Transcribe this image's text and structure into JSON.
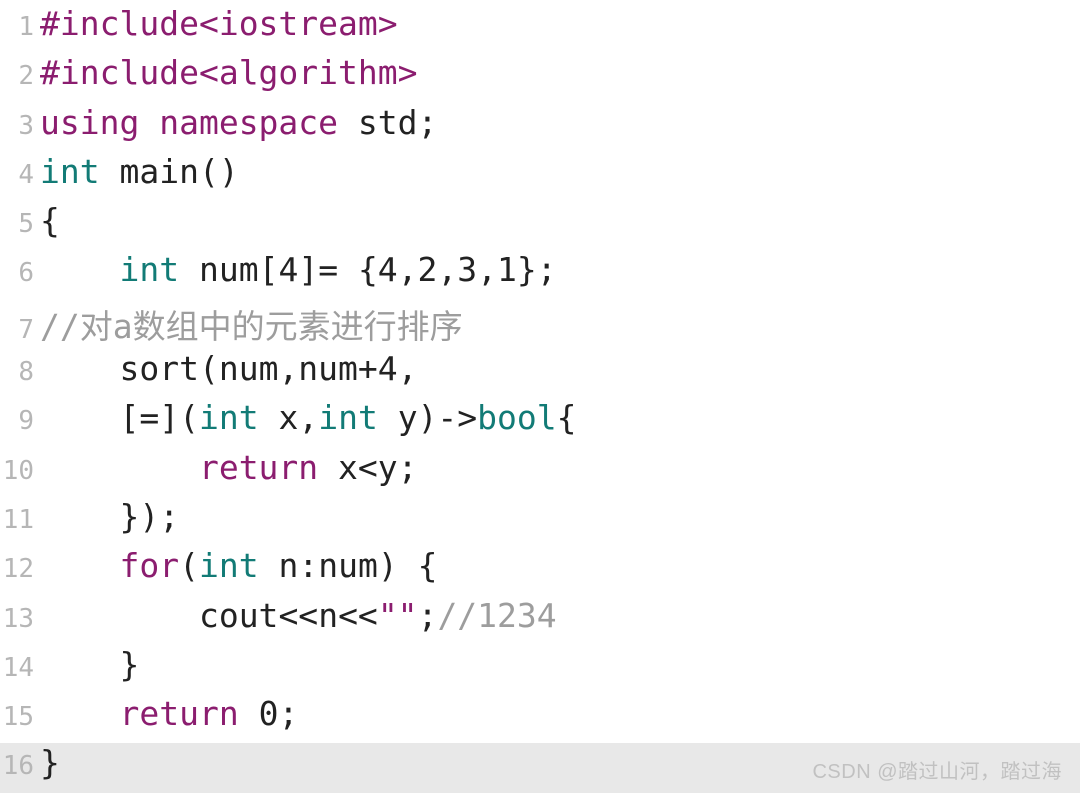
{
  "gutter": {
    "l1": "1",
    "l2": "2",
    "l3": "3",
    "l4": "4",
    "l5": "5",
    "l6": "6",
    "l7": "7",
    "l8": "8",
    "l9": "9",
    "l10": "10",
    "l11": "11",
    "l12": "12",
    "l13": "13",
    "l14": "14",
    "l15": "15",
    "l16": "16"
  },
  "tok": {
    "include1": "#include",
    "inc_io": "<iostream>",
    "include2": "#include",
    "inc_alg": "<algorithm>",
    "using": "using",
    "namespace": "namespace",
    "std": "std",
    "semi": ";",
    "int": "int",
    "main": "main",
    "parens": "()",
    "obr": "{",
    "cbr": "}",
    "indent1": "    ",
    "indent2": "        ",
    "num_id": "num",
    "arr4": "[4]",
    "eq": "=",
    "arr_init": "{4,2,3,1}",
    "cmt_sort": "//对a数组中的元素进行排序",
    "sort": "sort",
    "sort_args": "(num,num+4,",
    "lam_head": "[=](",
    "x_id": "x",
    "comma": ",",
    "y_id": "y",
    "arrow": ")->",
    "bool_ty": "bool",
    "return_kw": "return",
    "xlty": "x<y",
    "lam_close": "})",
    "for_kw": "for",
    "for_open": "(",
    "n_id": "n",
    "colon": ":",
    "for_close": ")",
    "cout": "cout",
    "ltlt1": "<<",
    "ltlt2": "<<",
    "emptystr": "\"\"",
    "cmt_out": "//1234",
    "zero": "0"
  },
  "watermark": "CSDN @踏过山河，踏过海"
}
